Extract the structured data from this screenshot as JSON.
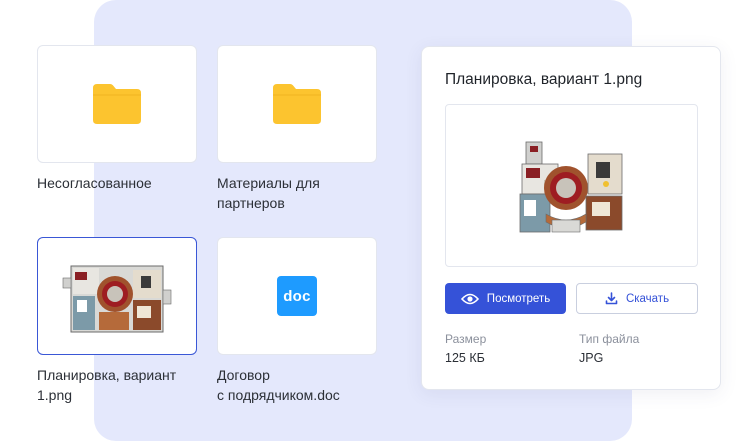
{
  "files": [
    {
      "name": "Несогласованное",
      "type": "folder"
    },
    {
      "name": "Материалы для партнеров",
      "type": "folder"
    },
    {
      "name": "Планировка, вариант 1.png",
      "type": "image",
      "selected": true
    },
    {
      "name": "Договор с подрядчиком.doc",
      "type": "doc",
      "badge": "doc"
    }
  ],
  "labels": {
    "file1_line1": "Несогласованное",
    "file2_line1": "Материалы для",
    "file2_line2": "партнеров",
    "file3_line1": "Планировка, вариант",
    "file3_line2": "1.png",
    "file4_line1": "Договор",
    "file4_line2": "с подрядчиком.doc"
  },
  "doc_badge": "doc",
  "details": {
    "title": "Планировка, вариант 1.png",
    "view_button": "Посмотреть",
    "download_button": "Скачать",
    "size_label": "Размер",
    "size_value": "125 КБ",
    "type_label": "Тип файла",
    "type_value": "JPG"
  },
  "colors": {
    "backdrop": "#e4e8fc",
    "folder": "#fcc42f",
    "doc_badge": "#1e9bff",
    "primary": "#3552d8",
    "selected_border": "#3a57d6"
  },
  "icons": {
    "folder": "folder-icon",
    "doc": "doc-file-icon",
    "view": "eye-icon",
    "download": "download-icon"
  }
}
